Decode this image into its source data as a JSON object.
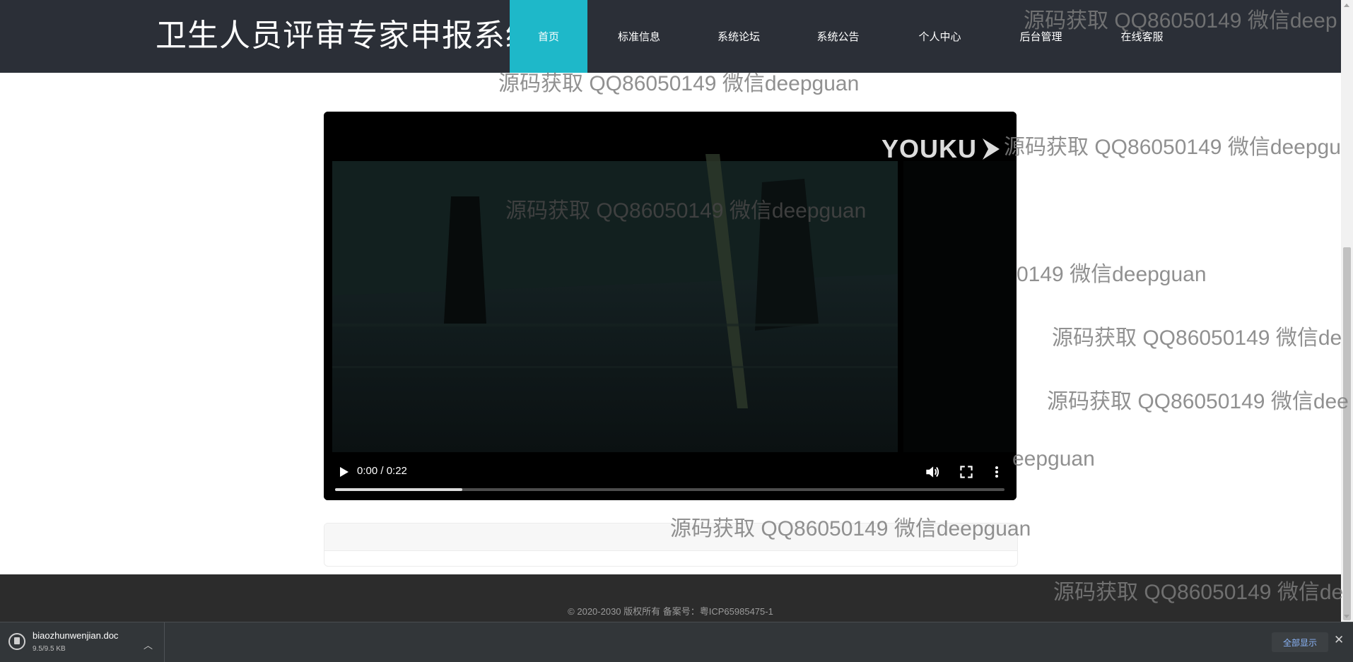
{
  "header": {
    "brand": "卫生人员评审专家申报系统",
    "nav": [
      "首页",
      "标准信息",
      "系统论坛",
      "系统公告",
      "个人中心",
      "后台管理",
      "在线客服"
    ],
    "active_index": 0
  },
  "video": {
    "logo_text": "YOUKU",
    "time": "0:00 / 0:22",
    "progress_fraction": 0.19
  },
  "footer": {
    "copyright": "© 2020-2030 版权所有 备案号：粤ICP65985475-1"
  },
  "download": {
    "file_name": "biaozhunwenjian.doc",
    "file_size": "9.5/9.5 KB",
    "show_all": "全部显示"
  },
  "watermarks": {
    "full": "源码获取 QQ86050149 微信deepguan",
    "top_right": "源码获取 QQ86050149 微信deep",
    "row_2": "源码获取 QQ86050149 微信deepgu",
    "row_3": "0149 微信deepguan",
    "row_4": "源码获取 QQ86050149 微信de",
    "row_5": "源码获取 QQ86050149 微信dee",
    "row_6": "eepguan",
    "row_8": "源码获取 QQ86050149 微信de"
  },
  "colors": {
    "header_bg": "#2b2f37",
    "nav_active_bg": "#1eb8c9",
    "footer_bg": "#2c2c2c",
    "download_bar_bg": "#323639"
  }
}
